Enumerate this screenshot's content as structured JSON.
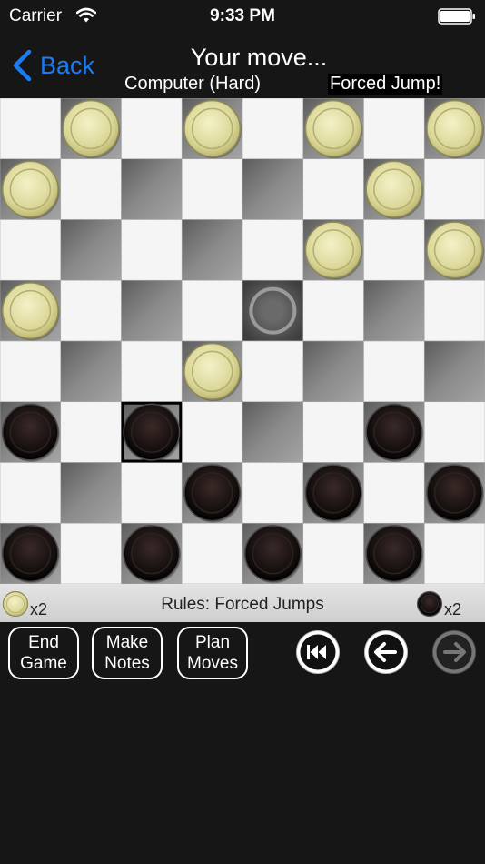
{
  "status": {
    "carrier": "Carrier",
    "time": "9:33 PM"
  },
  "nav": {
    "back_label": "Back",
    "title": "Your move...",
    "opponent": "Computer (Hard)",
    "alert": "Forced Jump!"
  },
  "board": {
    "size": 8,
    "light_square_color": "#f5f5f5",
    "dark_square_color": "#888888",
    "pieces": [
      {
        "row": 0,
        "col": 1,
        "color": "light"
      },
      {
        "row": 0,
        "col": 3,
        "color": "light"
      },
      {
        "row": 0,
        "col": 5,
        "color": "light"
      },
      {
        "row": 0,
        "col": 7,
        "color": "light"
      },
      {
        "row": 1,
        "col": 0,
        "color": "light"
      },
      {
        "row": 1,
        "col": 6,
        "color": "light"
      },
      {
        "row": 2,
        "col": 5,
        "color": "light"
      },
      {
        "row": 2,
        "col": 7,
        "color": "light"
      },
      {
        "row": 3,
        "col": 0,
        "color": "light"
      },
      {
        "row": 4,
        "col": 3,
        "color": "light"
      },
      {
        "row": 5,
        "col": 0,
        "color": "dark"
      },
      {
        "row": 5,
        "col": 2,
        "color": "dark",
        "selected": true
      },
      {
        "row": 5,
        "col": 6,
        "color": "dark"
      },
      {
        "row": 6,
        "col": 3,
        "color": "dark"
      },
      {
        "row": 6,
        "col": 5,
        "color": "dark"
      },
      {
        "row": 6,
        "col": 7,
        "color": "dark"
      },
      {
        "row": 7,
        "col": 0,
        "color": "dark"
      },
      {
        "row": 7,
        "col": 2,
        "color": "dark"
      },
      {
        "row": 7,
        "col": 4,
        "color": "dark"
      },
      {
        "row": 7,
        "col": 6,
        "color": "dark"
      }
    ],
    "highlight_square": {
      "row": 3,
      "col": 4
    }
  },
  "info": {
    "light_captured": "x2",
    "rules": "Rules: Forced Jumps",
    "dark_captured": "x2"
  },
  "toolbar": {
    "end_game": [
      "End",
      "Game"
    ],
    "make_notes": [
      "Make",
      "Notes"
    ],
    "plan_moves": [
      "Plan",
      "Moves"
    ]
  },
  "icons": {
    "first_move": "rewind-to-start-icon",
    "undo": "arrow-left-icon",
    "redo": "arrow-right-icon"
  }
}
